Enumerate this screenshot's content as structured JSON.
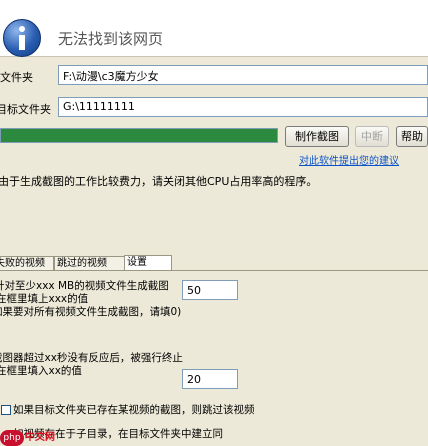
{
  "header": {
    "title": "无法找到该网页",
    "icon": "info-icon"
  },
  "source": {
    "label": "原文件夹",
    "value": "F:\\动漫\\c3魔方少女"
  },
  "target": {
    "label": "目标文件夹",
    "value": "G:\\11111111"
  },
  "progress": {
    "fraction": 1.0,
    "color": "#2b8a3e"
  },
  "buttons": {
    "make": "制作截图",
    "stop": "中断",
    "help": "帮助"
  },
  "link": {
    "text": "对此软件提出您的建议"
  },
  "note": "由于生成截图的工作比较费力，请关闭其他CPU占用率高的程序。",
  "tabs": [
    {
      "label": "失败的视频"
    },
    {
      "label": "跳过的视频"
    },
    {
      "label": "设置"
    }
  ],
  "settings": {
    "size": {
      "line1": "针对至少xxx MB的视频文件生成截图",
      "line2": "在框里填上xxx的值",
      "line3": "如果要对所有视频文件生成截图，请填0)",
      "value": "50"
    },
    "timeout": {
      "line1": "截图器超过xx秒没有反应后，被强行终止",
      "line2": "在框里填入xx的值",
      "value": "20"
    },
    "skip": {
      "line1": "如果目标文件夹已存在某视频的截图，则跳过该视频",
      "line2": "如视频存在于子目录，在目标文件夹中建立同"
    }
  },
  "watermark": {
    "icon_text": "php",
    "text": "中文网"
  }
}
